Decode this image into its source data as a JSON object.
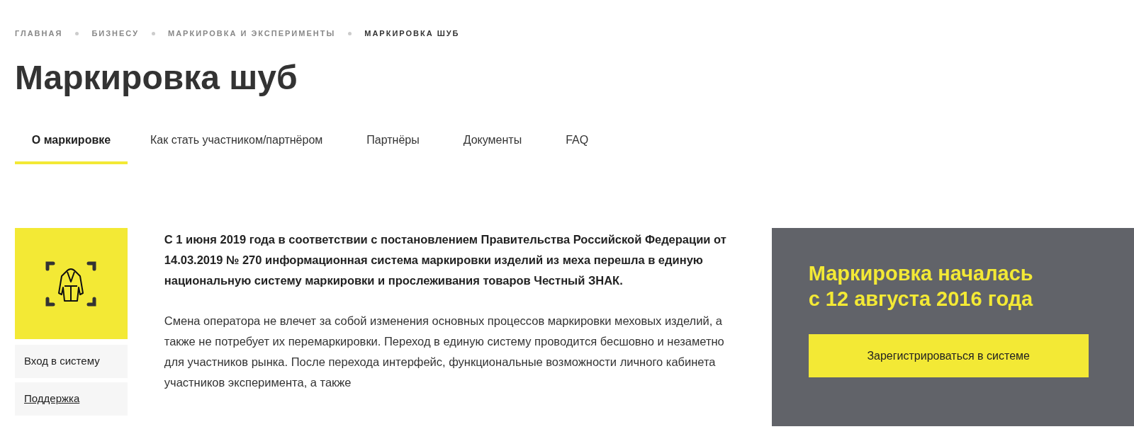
{
  "breadcrumbs": [
    {
      "label": "ГЛАВНАЯ",
      "selected": false
    },
    {
      "label": "БИЗНЕСУ",
      "selected": false
    },
    {
      "label": "МАРКИРОВКА И ЭКСПЕРИМЕНТЫ",
      "selected": false
    },
    {
      "label": "МАРКИРОВКА ШУБ",
      "selected": true
    }
  ],
  "title": "Маркировка шуб",
  "tabs": [
    {
      "label": "О маркировке",
      "selected": true
    },
    {
      "label": "Как стать участником/партнёром",
      "selected": false
    },
    {
      "label": "Партнёры",
      "selected": false
    },
    {
      "label": "Документы",
      "selected": false
    },
    {
      "label": "FAQ",
      "selected": false
    }
  ],
  "sidebar": {
    "links": [
      {
        "label": "Вход в систему",
        "underlined": false
      },
      {
        "label": "Поддержка",
        "underlined": true
      }
    ]
  },
  "article": {
    "paragraphs": [
      {
        "kind": "lead",
        "text": "С 1 июня 2019 года в соответствии с постановлением Правительства Российской Федерации от 14.03.2019 № 270 информационная система маркировки изделий из меха перешла в единую национальную систему маркировки и прослеживания товаров Честный ЗНАК."
      },
      {
        "kind": "body",
        "text": "Смена оператора не влечет за собой изменения основных процессов маркировки меховых изделий, а также не потребует их перемаркировки. Переход в единую систему проводится бесшовно и незаметно для участников рынка. После перехода интерфейс, функциональные возможности личного кабинета участников эксперимента, а также"
      }
    ]
  },
  "promo": {
    "heading_lines": [
      "Маркировка началась",
      "с 12 августа 2016 года"
    ],
    "button": "Зарегистрироваться в системе"
  }
}
